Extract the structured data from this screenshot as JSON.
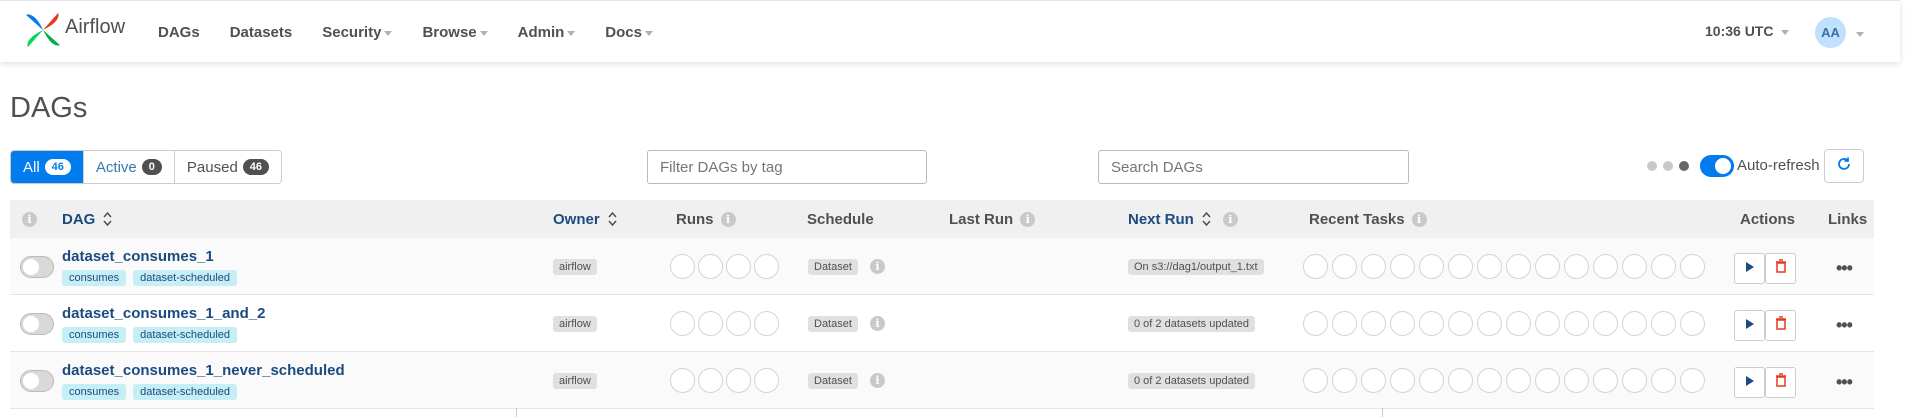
{
  "nav": {
    "brand": "Airflow",
    "items": [
      {
        "label": "DAGs",
        "dropdown": false
      },
      {
        "label": "Datasets",
        "dropdown": false
      },
      {
        "label": "Security",
        "dropdown": true
      },
      {
        "label": "Browse",
        "dropdown": true
      },
      {
        "label": "Admin",
        "dropdown": true
      },
      {
        "label": "Docs",
        "dropdown": true
      }
    ],
    "clock": "10:36 UTC",
    "avatar": "AA"
  },
  "page_title": "DAGs",
  "status_filters": [
    {
      "label": "All",
      "count": "46",
      "active": true
    },
    {
      "label": "Active",
      "count": "0",
      "active": false
    },
    {
      "label": "Paused",
      "count": "46",
      "active": false
    }
  ],
  "tag_filter": {
    "placeholder": "Filter DAGs by tag"
  },
  "search": {
    "placeholder": "Search DAGs"
  },
  "auto_refresh": {
    "label": "Auto-refresh",
    "enabled": true
  },
  "table": {
    "headers": {
      "dag": "DAG",
      "owner": "Owner",
      "runs": "Runs",
      "schedule": "Schedule",
      "last_run": "Last Run",
      "next_run": "Next Run",
      "recent_tasks": "Recent Tasks",
      "actions": "Actions",
      "links": "Links"
    },
    "rows": [
      {
        "dag_id": "dataset_consumes_1",
        "tags": [
          "consumes",
          "dataset-scheduled"
        ],
        "owner": "airflow",
        "schedule": "Dataset",
        "next_run": "On s3://dag1/output_1.txt",
        "paused": true
      },
      {
        "dag_id": "dataset_consumes_1_and_2",
        "tags": [
          "consumes",
          "dataset-scheduled"
        ],
        "owner": "airflow",
        "schedule": "Dataset",
        "next_run": "0 of 2 datasets updated",
        "paused": true
      },
      {
        "dag_id": "dataset_consumes_1_never_scheduled",
        "tags": [
          "consumes",
          "dataset-scheduled"
        ],
        "owner": "airflow",
        "schedule": "Dataset",
        "next_run": "0 of 2 datasets updated",
        "paused": true
      }
    ]
  },
  "colors": {
    "accent": "#017cee",
    "link": "#1c4b80",
    "tag_bg": "#c5eef5",
    "delete": "#e43921"
  }
}
